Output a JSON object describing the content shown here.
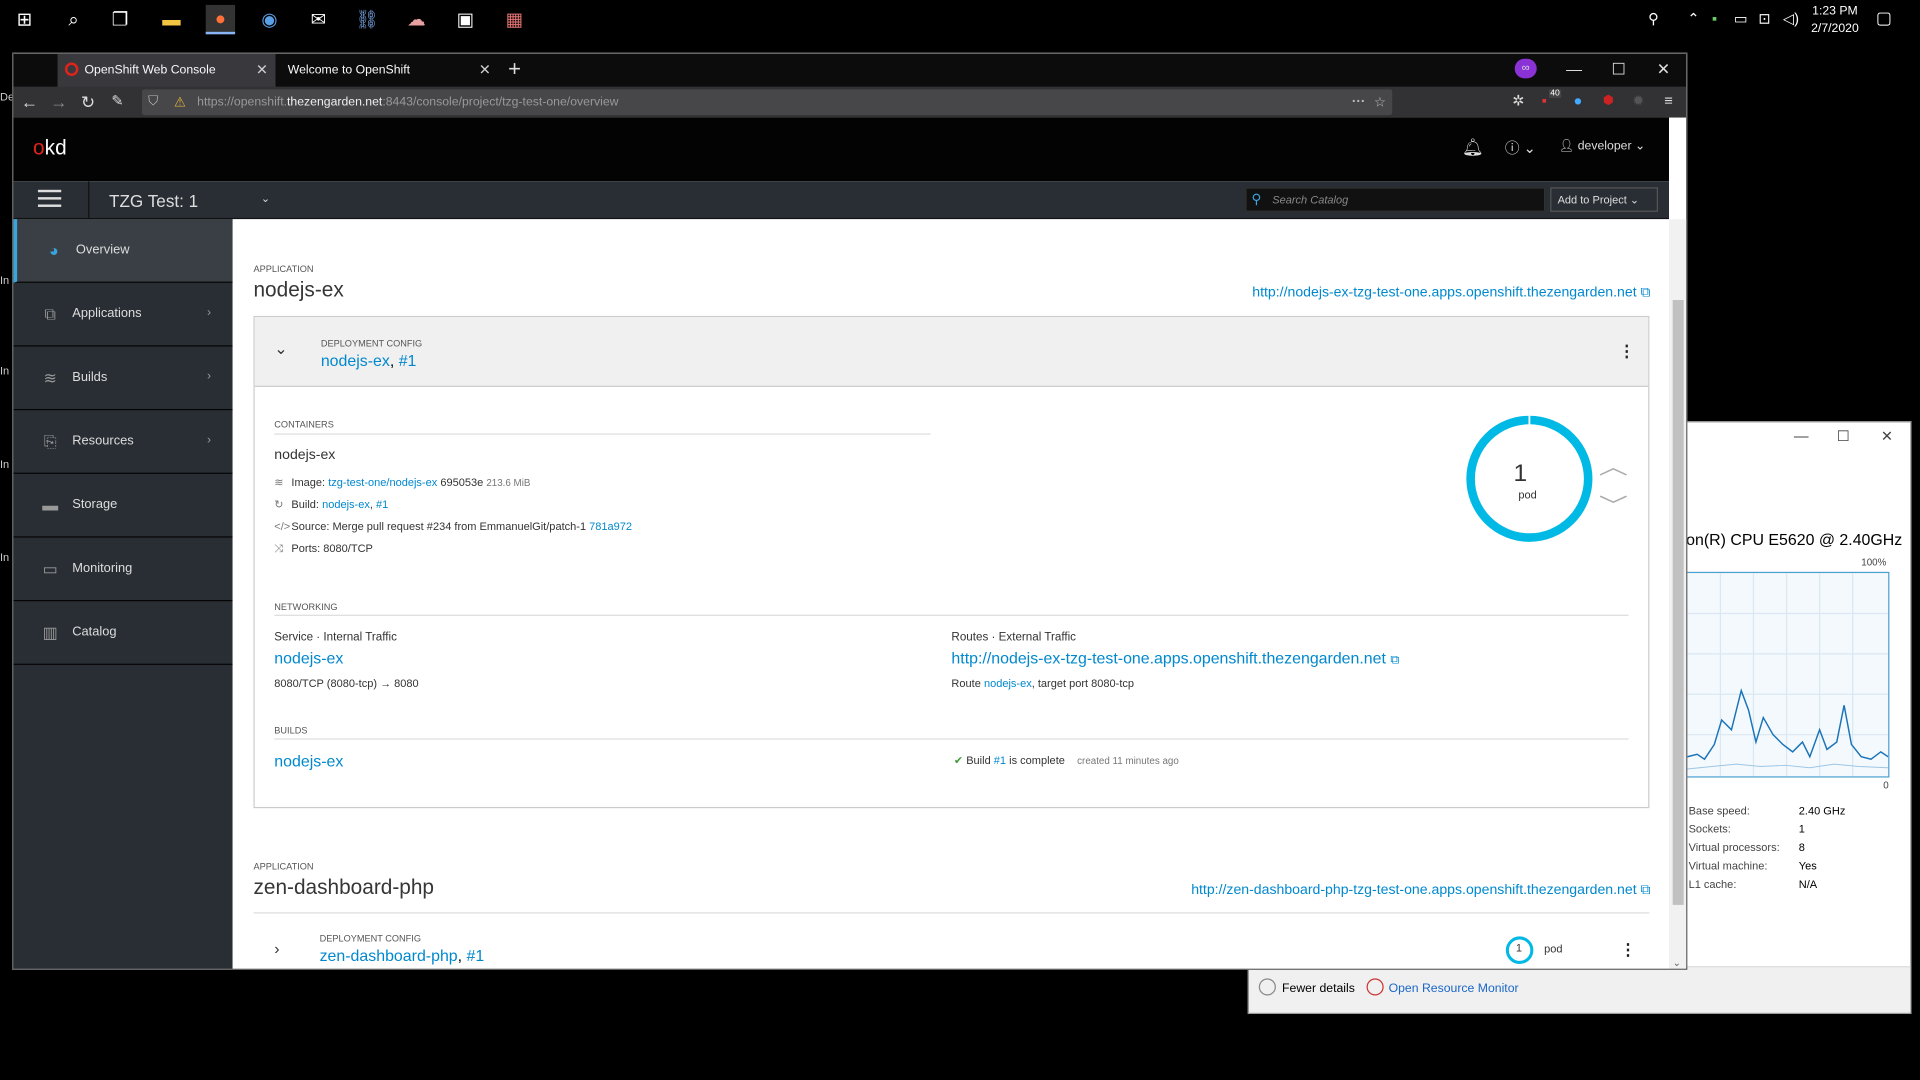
{
  "taskbar": {
    "clock_time": "1:23 PM",
    "clock_date": "2/7/2020"
  },
  "desktop_slivers": [
    "De",
    "In",
    "In",
    "In",
    "In"
  ],
  "task_manager": {
    "cpu_name": "on(R) CPU E5620 @ 2.40GHz",
    "graph_max": "100%",
    "graph_min": "0",
    "stats": [
      {
        "label": "Base speed:",
        "value": "2.40 GHz"
      },
      {
        "label": "Sockets:",
        "value": "1"
      },
      {
        "label": "Virtual processors:",
        "value": "8"
      },
      {
        "label": "Virtual machine:",
        "value": "Yes"
      },
      {
        "label": "L1 cache:",
        "value": "N/A"
      }
    ],
    "fewer_details": "Fewer details",
    "open_resource_monitor": "Open Resource Monitor"
  },
  "browser": {
    "tabs": [
      {
        "title": "OpenShift Web Console",
        "active": true
      },
      {
        "title": "Welcome to OpenShift",
        "active": false
      }
    ],
    "url_prefix": "https://openshift.",
    "url_host": "thezengarden.net",
    "url_rest": ":8443/console/project/tzg-test-one/overview",
    "badge_count": "40"
  },
  "okd": {
    "logo_o": "o",
    "logo_kd": "kd",
    "user": "developer",
    "project": "TZG Test: 1",
    "search_placeholder": "Search Catalog",
    "add_to_project": "Add to Project"
  },
  "sidebar": {
    "items": [
      {
        "label": "Overview",
        "icon": "dashboard-icon",
        "active": true
      },
      {
        "label": "Applications",
        "icon": "cubes-icon"
      },
      {
        "label": "Builds",
        "icon": "layers-icon"
      },
      {
        "label": "Resources",
        "icon": "files-icon"
      },
      {
        "label": "Storage",
        "icon": "storage-icon"
      },
      {
        "label": "Monitoring",
        "icon": "monitor-icon"
      },
      {
        "label": "Catalog",
        "icon": "catalog-icon"
      }
    ]
  },
  "app1": {
    "section_label": "APPLICATION",
    "name": "nodejs-ex",
    "url": "http://nodejs-ex-tzg-test-one.apps.openshift.thezengarden.net",
    "dc_label": "DEPLOYMENT CONFIG",
    "dc_name": "nodejs-ex",
    "dc_rev": "#1",
    "containers_label": "CONTAINERS",
    "container_name": "nodejs-ex",
    "image_label": "Image:",
    "image_link": "tzg-test-one/nodejs-ex",
    "image_hash": "695053e",
    "image_size": "213.6 MiB",
    "build_label": "Build:",
    "build_link": "nodejs-ex",
    "build_rev": "#1",
    "source_text": "Source: Merge pull request #234 from EmmanuelGit/patch-1",
    "source_commit": "781a972",
    "ports_text": "Ports: 8080/TCP",
    "pod_count": "1",
    "pod_label": "pod",
    "networking_label": "NETWORKING",
    "service_heading": "Service · Internal Traffic",
    "service_name": "nodejs-ex",
    "service_ports": "8080/TCP (8080-tcp) → 8080",
    "routes_heading": "Routes · External Traffic",
    "route_url": "http://nodejs-ex-tzg-test-one.apps.openshift.thezengarden.net",
    "route_prefix": "Route",
    "route_name": "nodejs-ex",
    "route_suffix": ", target port 8080-tcp",
    "builds_label": "BUILDS",
    "build_name": "nodejs-ex",
    "build_status_prefix": "Build",
    "build_status_rev": "#1",
    "build_status_suffix": "is complete",
    "build_created": "created 11 minutes ago"
  },
  "app2": {
    "section_label": "APPLICATION",
    "name": "zen-dashboard-php",
    "url": "http://zen-dashboard-php-tzg-test-one.apps.openshift.thezengarden.net",
    "dc_label": "DEPLOYMENT CONFIG",
    "dc_name": "zen-dashboard-php",
    "dc_rev": "#1",
    "pod_count": "1",
    "pod_label": "pod"
  },
  "colors": {
    "accent": "#0088ce",
    "donut": "#00b9e4",
    "sidebar_bg": "#292e34"
  }
}
